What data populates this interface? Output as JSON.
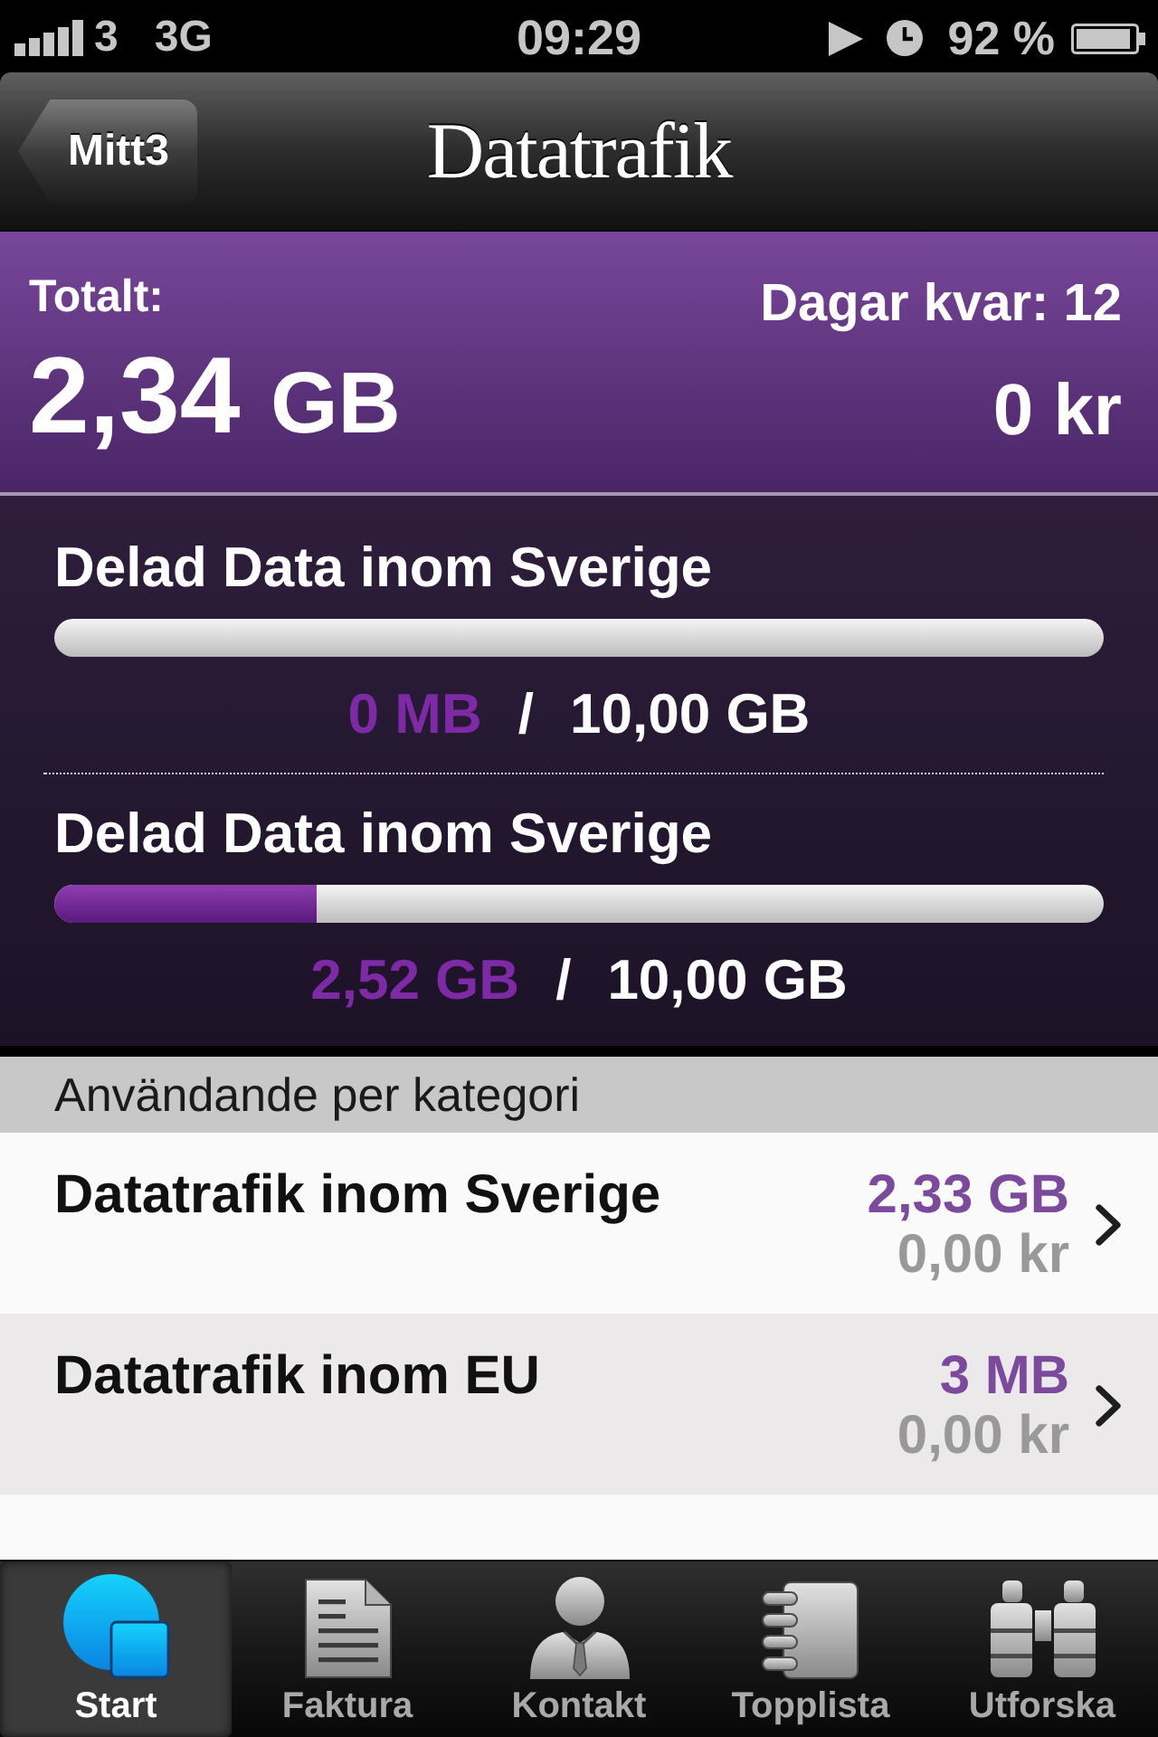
{
  "status_bar": {
    "carrier": "3",
    "network": "3G",
    "time": "09:29",
    "battery": "92 %"
  },
  "nav_bar": {
    "back_button": "Mitt3",
    "title": "Datatrafik"
  },
  "summary": {
    "total_label": "Totalt:",
    "total_value": "2,34",
    "total_unit": "GB",
    "days_left": "Dagar kvar: 12",
    "cost": "0 kr"
  },
  "meters": [
    {
      "title": "Delad Data inom Sverige",
      "used": "0 MB",
      "separator": "/",
      "limit": "10,00 GB"
    },
    {
      "title": "Delad Data inom Sverige",
      "level": 0.25,
      "used": "2,52 GB",
      "separator": "/",
      "limit": "10,00 GB"
    }
  ],
  "categories": {
    "title": "Användande per kategori",
    "rows": [
      {
        "title": "Datatrafik inom Sverige",
        "amount": "2,33 GB",
        "cost": "0,00 kr"
      },
      {
        "title": "Datatrafik inom EU",
        "amount": "3 MB",
        "cost": "0,00 kr"
      }
    ]
  },
  "tab_bar": [
    {
      "label": "Start",
      "selected": true
    },
    {
      "label": "Faktura",
      "selected": false
    },
    {
      "label": "Kontakt",
      "selected": false
    },
    {
      "label": "Topplista",
      "selected": false
    },
    {
      "label": "Utforska",
      "selected": false
    }
  ]
}
